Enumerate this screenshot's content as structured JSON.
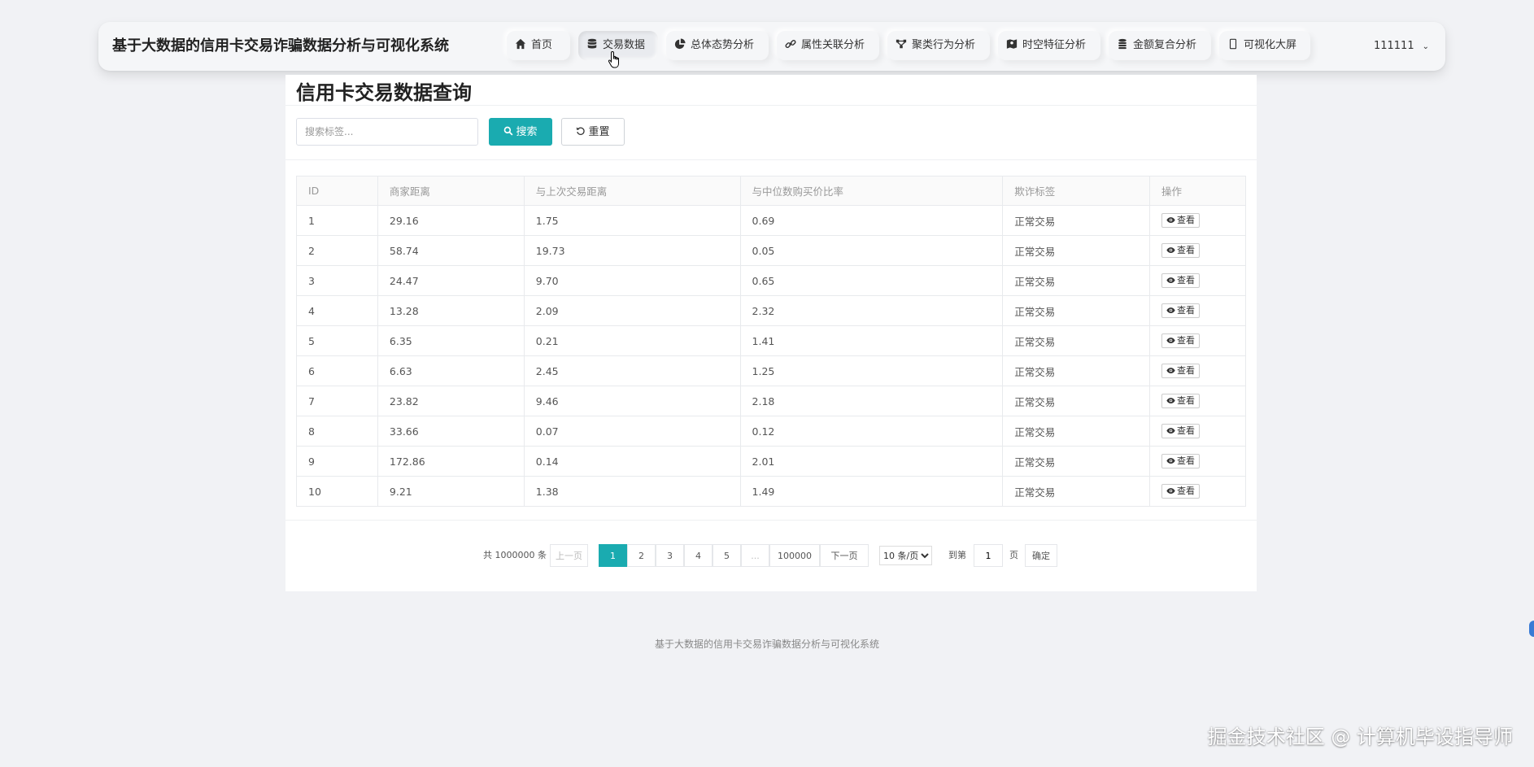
{
  "app": {
    "title": "基于大数据的信用卡交易诈骗数据分析与可视化系统"
  },
  "nav": {
    "items": [
      {
        "label": "首页",
        "icon": "home-icon"
      },
      {
        "label": "交易数据",
        "icon": "database-icon",
        "active": true
      },
      {
        "label": "总体态势分析",
        "icon": "pie-chart-icon"
      },
      {
        "label": "属性关联分析",
        "icon": "link-icon"
      },
      {
        "label": "聚类行为分析",
        "icon": "cluster-icon"
      },
      {
        "label": "时空特征分析",
        "icon": "map-icon"
      },
      {
        "label": "金额复合分析",
        "icon": "coins-icon"
      },
      {
        "label": "可视化大屏",
        "icon": "screen-icon"
      }
    ],
    "user": "111111"
  },
  "page": {
    "title": "信用卡交易数据查询",
    "search_placeholder": "搜索标签...",
    "search_label": "搜索",
    "reset_label": "重置"
  },
  "table": {
    "columns": [
      "ID",
      "商家距离",
      "与上次交易距离",
      "与中位数购买价比率",
      "欺诈标签",
      "操作"
    ],
    "action_label": "查看",
    "rows": [
      [
        "1",
        "29.16",
        "1.75",
        "0.69",
        "正常交易"
      ],
      [
        "2",
        "58.74",
        "19.73",
        "0.05",
        "正常交易"
      ],
      [
        "3",
        "24.47",
        "9.70",
        "0.65",
        "正常交易"
      ],
      [
        "4",
        "13.28",
        "2.09",
        "2.32",
        "正常交易"
      ],
      [
        "5",
        "6.35",
        "0.21",
        "1.41",
        "正常交易"
      ],
      [
        "6",
        "6.63",
        "2.45",
        "1.25",
        "正常交易"
      ],
      [
        "7",
        "23.82",
        "9.46",
        "2.18",
        "正常交易"
      ],
      [
        "8",
        "33.66",
        "0.07",
        "0.12",
        "正常交易"
      ],
      [
        "9",
        "172.86",
        "0.14",
        "2.01",
        "正常交易"
      ],
      [
        "10",
        "9.21",
        "1.38",
        "1.49",
        "正常交易"
      ]
    ]
  },
  "pagination": {
    "total": "共 1000000 条",
    "prev": "上一页",
    "pages": [
      "1",
      "2",
      "3",
      "4",
      "5",
      "...",
      "100000"
    ],
    "current": "1",
    "next": "下一页",
    "page_size": "10 条/页",
    "goto_label": "到第",
    "goto_value": "1",
    "page_unit": "页",
    "confirm": "确定"
  },
  "footer": {
    "text": "基于大数据的信用卡交易诈骗数据分析与可视化系统"
  },
  "watermark": "掘金技术社区 @ 计算机毕设指导师",
  "colors": {
    "accent": "#1aabb0",
    "background": "#f1f2f5"
  }
}
